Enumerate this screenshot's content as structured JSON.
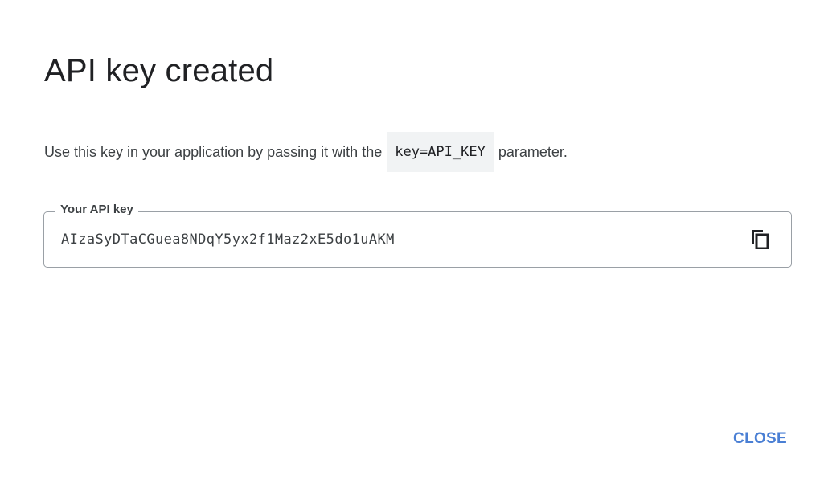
{
  "dialog": {
    "title": "API key created",
    "description_before": "Use this key in your application by passing it with the",
    "description_code": "key=API_KEY",
    "description_after": "parameter."
  },
  "key_field": {
    "label": "Your API key",
    "value": "AIzaSyDTaCGuea8NDqY5yx2f1Maz2xE5do1uAKM",
    "copy_icon": "copy-icon"
  },
  "actions": {
    "close_label": "CLOSE",
    "accent_color": "#4a7fd4"
  }
}
